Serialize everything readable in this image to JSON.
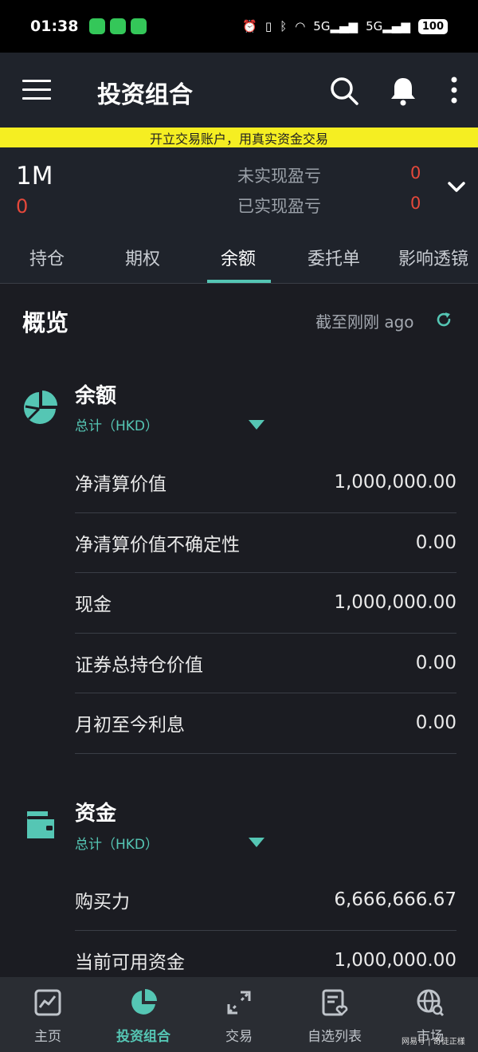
{
  "status": {
    "time": "01:38",
    "net1": "5G",
    "net2": "5G",
    "battery": "100"
  },
  "header": {
    "title": "投资组合"
  },
  "promo": {
    "text": "开立交易账户，用真实资金交易"
  },
  "summary": {
    "total": "1M",
    "total_change": "0",
    "unrealized_label": "未实现盈亏",
    "unrealized_value": "0",
    "realized_label": "已实现盈亏",
    "realized_value": "0"
  },
  "tabs": [
    {
      "label": "持仓"
    },
    {
      "label": "期权"
    },
    {
      "label": "余额"
    },
    {
      "label": "委托单"
    },
    {
      "label": "影响透镜"
    }
  ],
  "overview": {
    "title": "概览",
    "updated": "截至刚刚 ago"
  },
  "balance": {
    "title": "余额",
    "subtitle": "总计（HKD）",
    "rows": [
      {
        "label": "净清算价值",
        "value": "1,000,000.00"
      },
      {
        "label": "净清算价值不确定性",
        "value": "0.00"
      },
      {
        "label": "现金",
        "value": "1,000,000.00"
      },
      {
        "label": "证券总持仓价值",
        "value": "0.00"
      },
      {
        "label": "月初至今利息",
        "value": "0.00"
      }
    ]
  },
  "funds": {
    "title": "资金",
    "subtitle": "总计（HKD）",
    "rows": [
      {
        "label": "购买力",
        "value": "6,666,666.67"
      },
      {
        "label": "当前可用资金",
        "value": "1,000,000.00"
      }
    ]
  },
  "bottom_nav": [
    {
      "label": "主页",
      "icon": "home-chart-icon"
    },
    {
      "label": "投资组合",
      "icon": "pie-chart-icon"
    },
    {
      "label": "交易",
      "icon": "trade-arrows-icon"
    },
    {
      "label": "自选列表",
      "icon": "watchlist-icon"
    },
    {
      "label": "市场",
      "icon": "globe-search-icon"
    }
  ],
  "watermark": "网易号 | 奇徒正樣",
  "colors": {
    "accent": "#55c6b4",
    "negative": "#e5483b",
    "banner": "#f5ee22",
    "background": "#1b1c22"
  }
}
